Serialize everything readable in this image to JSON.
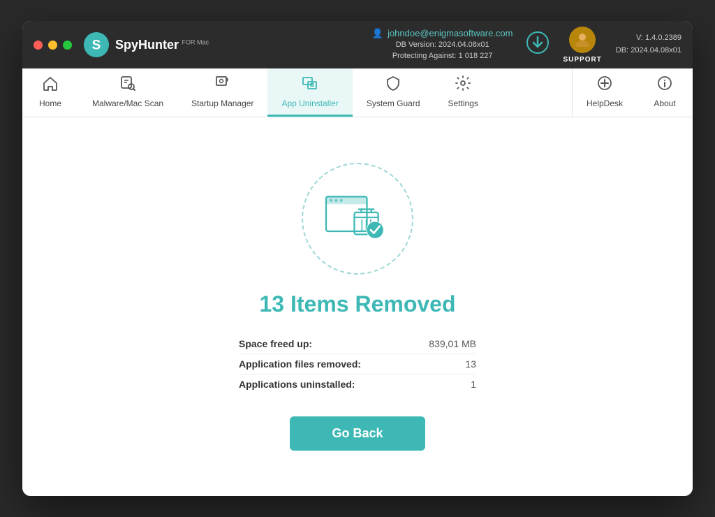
{
  "window": {
    "title": "SpyHunter for Mac"
  },
  "titlebar": {
    "logo_text": "SpyHunter",
    "logo_sub": "FOR Mac",
    "user_email": "johndoe@enigmasoftware.com",
    "db_version_label": "DB Version: 2024.04.08x01",
    "protecting_label": "Protecting Against: 1 018 227",
    "support_label": "SUPPORT",
    "version_label": "V: 1.4.0.2389",
    "db_label": "DB:  2024.04.08x01"
  },
  "navbar": {
    "items": [
      {
        "id": "home",
        "label": "Home",
        "icon": "🏠"
      },
      {
        "id": "malware-scan",
        "label": "Malware/Mac Scan",
        "icon": "🔍"
      },
      {
        "id": "startup-manager",
        "label": "Startup Manager",
        "icon": "⚙"
      },
      {
        "id": "app-uninstaller",
        "label": "App Uninstaller",
        "icon": "📋",
        "active": true
      },
      {
        "id": "system-guard",
        "label": "System Guard",
        "icon": "🛡"
      },
      {
        "id": "settings",
        "label": "Settings",
        "icon": "⚙️"
      }
    ],
    "right_items": [
      {
        "id": "helpdesk",
        "label": "HelpDesk",
        "icon": "➕"
      },
      {
        "id": "about",
        "label": "About",
        "icon": "ℹ"
      }
    ]
  },
  "main": {
    "title": "13 Items Removed",
    "stats": [
      {
        "label": "Space freed up:",
        "value": "839,01 MB"
      },
      {
        "label": "Application files removed:",
        "value": "13"
      },
      {
        "label": "Applications uninstalled:",
        "value": "1"
      }
    ],
    "go_back_label": "Go Back"
  }
}
